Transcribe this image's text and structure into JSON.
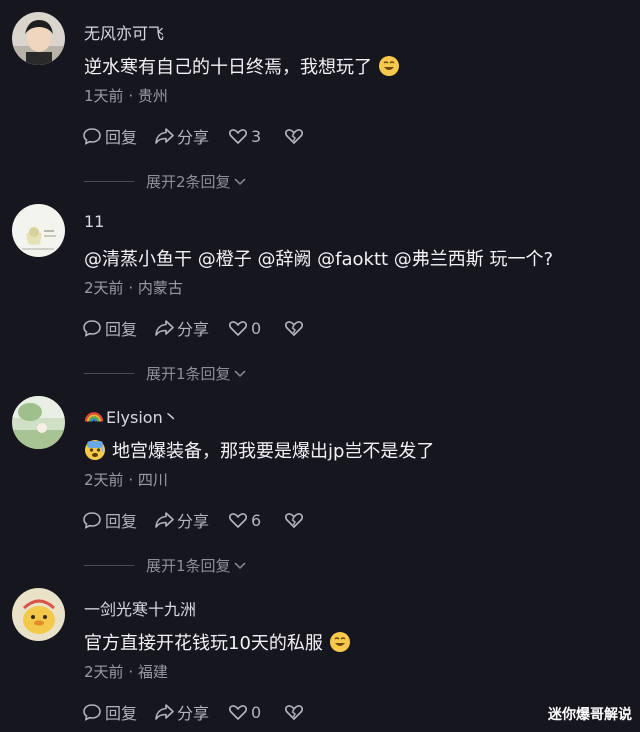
{
  "comments": [
    {
      "username": "无风亦可飞",
      "content": "逆水寒有自己的十日终焉，我想玩了",
      "emoji_after": "grin-emoji",
      "time": "1天前",
      "location": "贵州",
      "reply_label": "回复",
      "share_label": "分享",
      "likes": "3",
      "expand_label": "展开2条回复"
    },
    {
      "username": "11",
      "content": "@清蒸小鱼干  @橙子  @辞阙  @faoktt  @弗兰西斯  玩一个?",
      "time": "2天前",
      "location": "内蒙古",
      "reply_label": "回复",
      "share_label": "分享",
      "likes": "0",
      "expand_label": "展开1条回复"
    },
    {
      "username": "Elysion丶",
      "username_prefix_icon": "rainbow-icon",
      "content": "地宫爆装备，那我要是爆出jp岂不是发了",
      "emoji_before": "anxious-sweat-emoji",
      "time": "2天前",
      "location": "四川",
      "reply_label": "回复",
      "share_label": "分享",
      "likes": "6",
      "expand_label": "展开1条回复"
    },
    {
      "username": "一剑光寒十九洲",
      "content": "官方直接开花钱玩10天的私服",
      "emoji_after": "grin-emoji",
      "time": "2天前",
      "location": "福建",
      "reply_label": "回复",
      "share_label": "分享",
      "likes": "0"
    }
  ],
  "meta_separator": "·",
  "watermark": "迷你爆哥解说",
  "colors": {
    "background": "#16161e",
    "text_primary": "#f2f2f4",
    "text_secondary": "#9a9aa2"
  }
}
